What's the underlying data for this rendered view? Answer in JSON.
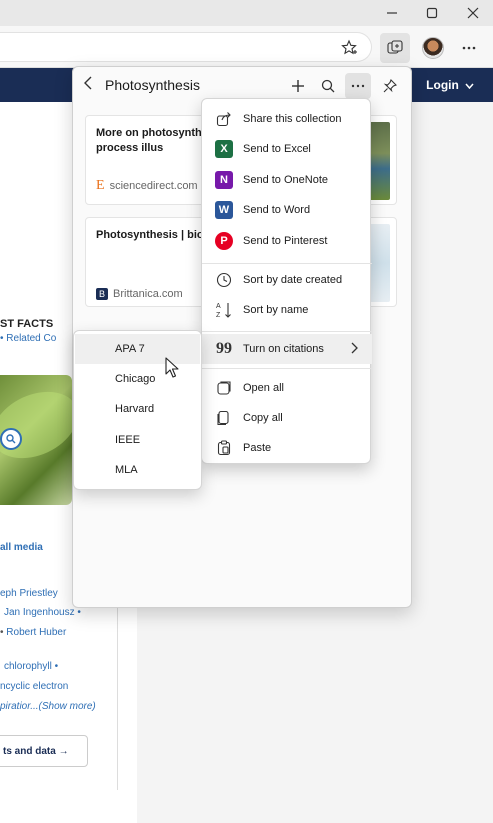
{
  "window": {
    "minimize_icon": "minimize-icon",
    "maximize_icon": "maximize-icon",
    "close_icon": "close-icon"
  },
  "toolbar": {
    "icons": [
      "favorite-star-icon",
      "collections-icon",
      "profile-avatar",
      "more-dots-icon"
    ]
  },
  "site": {
    "login_label": "Login",
    "facts_heading": "ST FACTS",
    "related_link": "• Related Co",
    "all_media": "all media",
    "links": [
      "eph Priestley",
      "Jan Ingenhousz  •",
      "Robert Huber",
      "chlorophyll  •",
      "ncyclic electron",
      "piratior...(Show more)"
    ],
    "facts_button": "ts and data →"
  },
  "collection": {
    "title": "Photosynthesis",
    "cards": [
      {
        "title": "More on photosynth detailed process illus",
        "source": "sciencedirect.com",
        "source_logo": "E"
      },
      {
        "title": "Photosynthesis | biol",
        "source": "Brittanica.com",
        "source_logo": "B"
      }
    ]
  },
  "menu": {
    "items": [
      {
        "label": "Share this collection",
        "icon": "share-icon"
      },
      {
        "label": "Send to Excel",
        "icon": "excel-icon"
      },
      {
        "label": "Send to OneNote",
        "icon": "onenote-icon"
      },
      {
        "label": "Send to Word",
        "icon": "word-icon"
      },
      {
        "label": "Send to Pinterest",
        "icon": "pinterest-icon"
      },
      {
        "label": "Sort by date created",
        "icon": "clock-icon"
      },
      {
        "label": "Sort by name",
        "icon": "sort-az-icon"
      },
      {
        "label": "Turn on citations",
        "icon": "quote-icon"
      },
      {
        "label": "Open all",
        "icon": "open-all-icon"
      },
      {
        "label": "Copy all",
        "icon": "copy-icon"
      },
      {
        "label": "Paste",
        "icon": "paste-icon"
      }
    ]
  },
  "citations": {
    "options": [
      "APA 7",
      "Chicago",
      "Harvard",
      "IEEE",
      "MLA"
    ]
  },
  "colors": {
    "excel": "#1d7044",
    "onenote": "#7719aa",
    "word": "#2b579a",
    "pinterest": "#e60023",
    "site_nav": "#1a2d55",
    "link": "#2f6fb5"
  }
}
